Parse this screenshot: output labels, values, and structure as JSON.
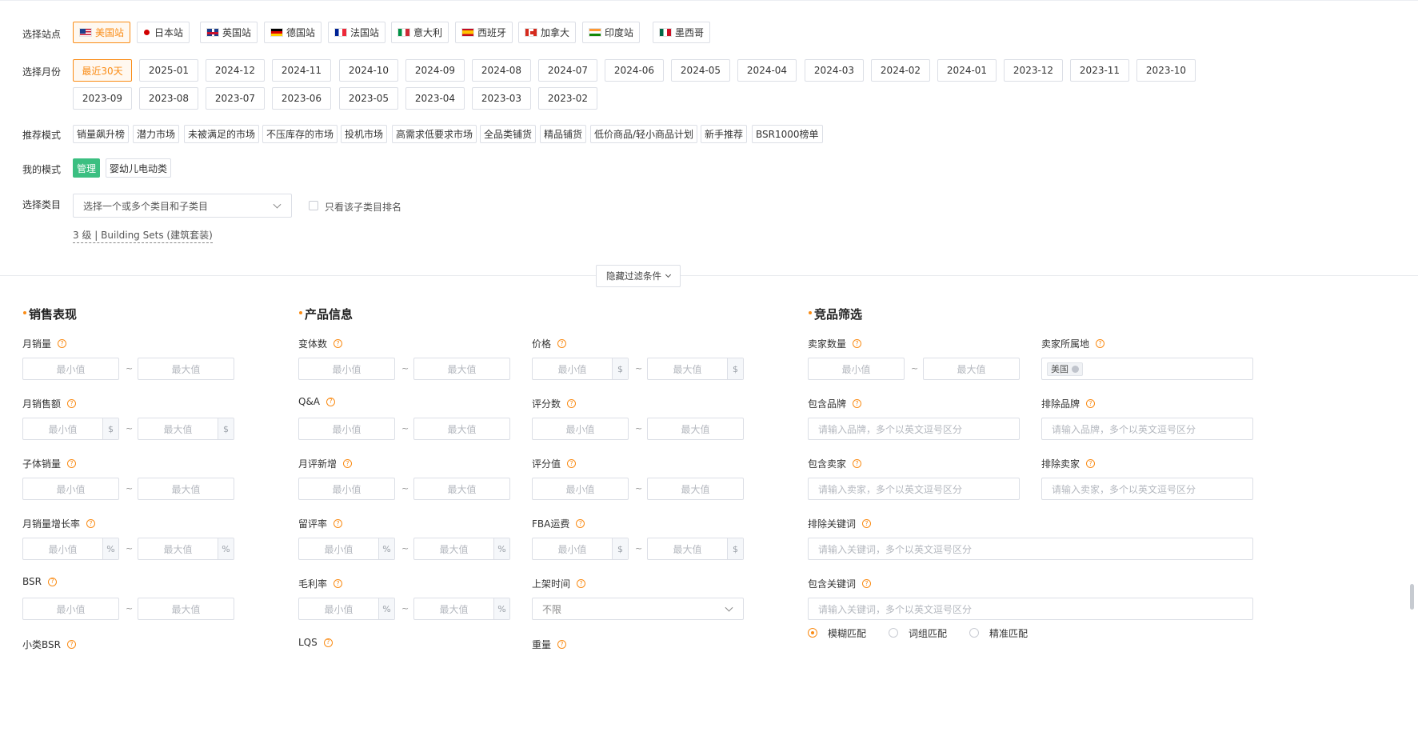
{
  "labels": {
    "site": "选择站点",
    "month": "选择月份",
    "recommend": "推荐模式",
    "mine": "我的模式",
    "category": "选择类目"
  },
  "sites": [
    {
      "label": "美国站",
      "flag": "us"
    },
    {
      "label": "日本站",
      "flag": "jp"
    },
    {
      "label": "英国站",
      "flag": "uk"
    },
    {
      "label": "德国站",
      "flag": "de"
    },
    {
      "label": "法国站",
      "flag": "fr"
    },
    {
      "label": "意大利",
      "flag": "it"
    },
    {
      "label": "西班牙",
      "flag": "es"
    },
    {
      "label": "加拿大",
      "flag": "ca"
    },
    {
      "label": "印度站",
      "flag": "in"
    },
    {
      "label": "墨西哥",
      "flag": "mx"
    }
  ],
  "months": [
    "最近30天",
    "2025-01",
    "2024-12",
    "2024-11",
    "2024-10",
    "2024-09",
    "2024-08",
    "2024-07",
    "2024-06",
    "2024-05",
    "2024-04",
    "2024-03",
    "2024-02",
    "2024-01",
    "2023-12",
    "2023-11",
    "2023-10",
    "2023-09",
    "2023-08",
    "2023-07",
    "2023-06",
    "2023-05",
    "2023-04",
    "2023-03",
    "2023-02"
  ],
  "recommend_modes": [
    "销量飙升榜",
    "潜力市场",
    "未被满足的市场",
    "不压库存的市场",
    "投机市场",
    "高需求低要求市场",
    "全品类铺货",
    "精品铺货",
    "低价商品/轻小商品计划",
    "新手推荐",
    "BSR1000榜单"
  ],
  "my_modes": [
    "管理",
    "婴幼儿电动类"
  ],
  "category": {
    "placeholder": "选择一个或多个类目和子类目",
    "only_sub_label": "只看该子类目排名",
    "selected": "3 级 | Building Sets (建筑套装)"
  },
  "toggle_label": "隐藏过滤条件",
  "placeholders": {
    "min": "最小值",
    "max": "最大值",
    "tilde": "~"
  },
  "suffix": {
    "dollar": "$",
    "percent": "%"
  },
  "sections": {
    "sales": "销售表现",
    "product": "产品信息",
    "competitor": "竞品筛选"
  },
  "sales_fields": [
    "月销量",
    "月销售额",
    "子体销量",
    "月销量增长率",
    "BSR",
    "小类BSR"
  ],
  "product_fields": [
    "变体数",
    "Q&A",
    "月评新增",
    "留评率",
    "毛利率",
    "LQS"
  ],
  "product_fields_2": [
    "价格",
    "评分数",
    "评分值",
    "FBA运费",
    "上架时间",
    "重量"
  ],
  "launch_time_value": "不限",
  "competitor_fields": {
    "seller_count": "卖家数量",
    "seller_location": "卖家所属地",
    "seller_location_tag": "美国",
    "include_brand": "包含品牌",
    "exclude_brand": "排除品牌",
    "brand_placeholder": "请输入品牌，多个以英文逗号区分",
    "include_seller": "包含卖家",
    "exclude_seller": "排除卖家",
    "seller_placeholder": "请输入卖家，多个以英文逗号区分",
    "exclude_keyword": "排除关键词",
    "include_keyword": "包含关键词",
    "keyword_placeholder": "请输入关键词，多个以英文逗号区分"
  },
  "match_modes": [
    "模糊匹配",
    "词组匹配",
    "精准匹配"
  ],
  "colors": {
    "accent": "#fa8c16",
    "green": "#3bbf81"
  }
}
